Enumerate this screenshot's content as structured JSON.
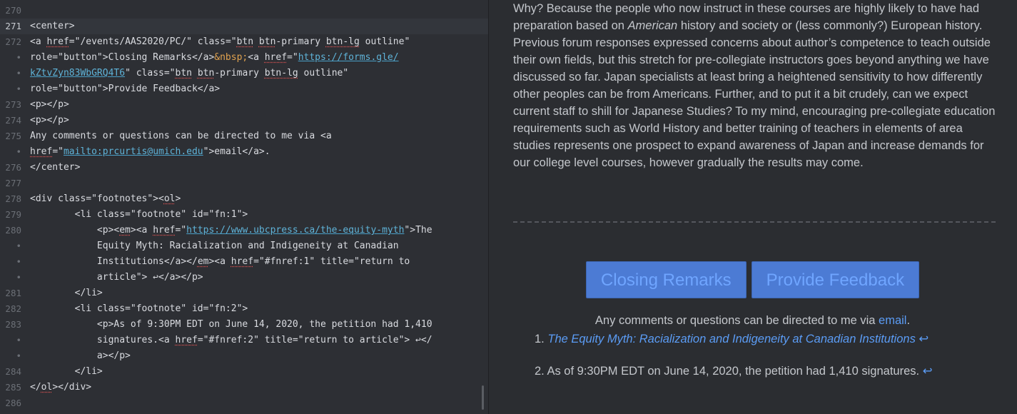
{
  "editor": {
    "lines": [
      {
        "no": "270",
        "parts": [
          {
            "t": ""
          }
        ]
      },
      {
        "no": "271",
        "active": true,
        "parts": [
          {
            "t": "<center>"
          }
        ]
      },
      {
        "no": "272",
        "parts": [
          {
            "t": "<a "
          },
          {
            "t": "href",
            "s": "spell"
          },
          {
            "t": "=\"/events/AAS2020/PC/\" class=\""
          },
          {
            "t": "btn",
            "s": "spell"
          },
          {
            "t": " "
          },
          {
            "t": "btn",
            "s": "spell"
          },
          {
            "t": "-primary "
          },
          {
            "t": "btn-lg",
            "s": "spell"
          },
          {
            "t": " outline\""
          }
        ]
      },
      {
        "no": "•",
        "parts": [
          {
            "t": "role=\"button\">Closing Remarks</a>"
          },
          {
            "t": "&nbsp;",
            "s": "ent"
          },
          {
            "t": "<a "
          },
          {
            "t": "href",
            "s": "spell"
          },
          {
            "t": "=\""
          },
          {
            "t": "https://forms.gle/",
            "s": "lnk"
          }
        ]
      },
      {
        "no": "•",
        "parts": [
          {
            "t": "kZtvZyn83WbGRQ4T6",
            "s": "lnk"
          },
          {
            "t": "\" class=\""
          },
          {
            "t": "btn",
            "s": "spell"
          },
          {
            "t": " "
          },
          {
            "t": "btn",
            "s": "spell"
          },
          {
            "t": "-primary "
          },
          {
            "t": "btn-lg",
            "s": "spell"
          },
          {
            "t": " outline\""
          }
        ]
      },
      {
        "no": "•",
        "parts": [
          {
            "t": "role=\"button\">Provide Feedback</a>"
          }
        ]
      },
      {
        "no": "273",
        "parts": [
          {
            "t": "<p></p>"
          }
        ]
      },
      {
        "no": "274",
        "parts": [
          {
            "t": "<p></p>"
          }
        ]
      },
      {
        "no": "275",
        "parts": [
          {
            "t": "Any comments or questions can be directed to me via <a"
          }
        ]
      },
      {
        "no": "•",
        "parts": [
          {
            "t": "href",
            "s": "spell"
          },
          {
            "t": "=\""
          },
          {
            "t": "mailto:prcurtis@umich.edu",
            "s": "lnk"
          },
          {
            "t": "\">email</a>."
          }
        ]
      },
      {
        "no": "276",
        "parts": [
          {
            "t": "</center>"
          }
        ]
      },
      {
        "no": "277",
        "parts": [
          {
            "t": ""
          }
        ]
      },
      {
        "no": "278",
        "parts": [
          {
            "t": "<div class=\"footnotes\"><"
          },
          {
            "t": "ol",
            "s": "spell"
          },
          {
            "t": ">"
          }
        ]
      },
      {
        "no": "279",
        "parts": [
          {
            "t": "        <li class=\"footnote\" id=\"fn:1\">"
          }
        ]
      },
      {
        "no": "280",
        "parts": [
          {
            "t": "            <p><"
          },
          {
            "t": "em",
            "s": "spell"
          },
          {
            "t": "><a "
          },
          {
            "t": "href",
            "s": "spell"
          },
          {
            "t": "=\""
          },
          {
            "t": "https://www.ubcpress.ca/the-equity-myth",
            "s": "lnk"
          },
          {
            "t": "\">The"
          }
        ]
      },
      {
        "no": "•",
        "parts": [
          {
            "t": "            Equity Myth: Racialization and Indigeneity at Canadian"
          }
        ]
      },
      {
        "no": "•",
        "parts": [
          {
            "t": "            Institutions</a></"
          },
          {
            "t": "em",
            "s": "spell"
          },
          {
            "t": "><a "
          },
          {
            "t": "href",
            "s": "spell"
          },
          {
            "t": "=\"#fnref:1\" title=\"return to"
          }
        ]
      },
      {
        "no": "•",
        "parts": [
          {
            "t": "            article\"> ↩</a></p>"
          }
        ]
      },
      {
        "no": "281",
        "parts": [
          {
            "t": "        </li>"
          }
        ]
      },
      {
        "no": "282",
        "parts": [
          {
            "t": "        <li class=\"footnote\" id=\"fn:2\">"
          }
        ]
      },
      {
        "no": "283",
        "parts": [
          {
            "t": "            <p>As of 9:30PM EDT on June 14, 2020, the petition had 1,410"
          }
        ]
      },
      {
        "no": "•",
        "parts": [
          {
            "t": "            signatures.<a "
          },
          {
            "t": "href",
            "s": "spell"
          },
          {
            "t": "=\"#fnref:2\" title=\"return to article\"> ↩</"
          }
        ]
      },
      {
        "no": "•",
        "parts": [
          {
            "t": "            a></p>"
          }
        ]
      },
      {
        "no": "284",
        "parts": [
          {
            "t": "        </li>"
          }
        ]
      },
      {
        "no": "285",
        "parts": [
          {
            "t": "</"
          },
          {
            "t": "ol",
            "s": "spell"
          },
          {
            "t": "></div>"
          }
        ]
      },
      {
        "no": "286",
        "parts": [
          {
            "t": ""
          }
        ]
      }
    ]
  },
  "preview": {
    "paragraph": [
      {
        "t": "Why? Because the people who now instruct in these courses are highly likely to have had preparation based on "
      },
      {
        "t": "American",
        "em": true
      },
      {
        "t": " history and society or (less commonly?) European history. Previous forum responses expressed concerns about author’s competence to teach outside their own fields, but this stretch for pre-collegiate instructors goes beyond anything we have discussed so far. Japan specialists at least bring a heightened sensitivity to how differently other peoples can be from Americans. Further, and to put it a bit crudely, can we expect current staff to shill for Japanese Studies? To my mind, encouraging pre-collegiate education requirements such as World History and better training of teachers in elements of area studies represents one prospect to expand awareness of Japan and increase demands for our college level courses, however gradually the results may come."
      }
    ],
    "buttons": {
      "closing": "Closing Remarks",
      "feedback": "Provide Feedback"
    },
    "contact": {
      "text": "Any comments or questions can be directed to me via ",
      "link": "email",
      "end": "."
    },
    "footnotes": [
      {
        "num": "1.",
        "link": "The Equity Myth: Racialization and Indigeneity at Canadian Institutions",
        "ret": "↩"
      },
      {
        "num": "2.",
        "text": "As of 9:30PM EDT on June 14, 2020, the petition had 1,410 signatures.",
        "ret": "↩"
      }
    ]
  }
}
